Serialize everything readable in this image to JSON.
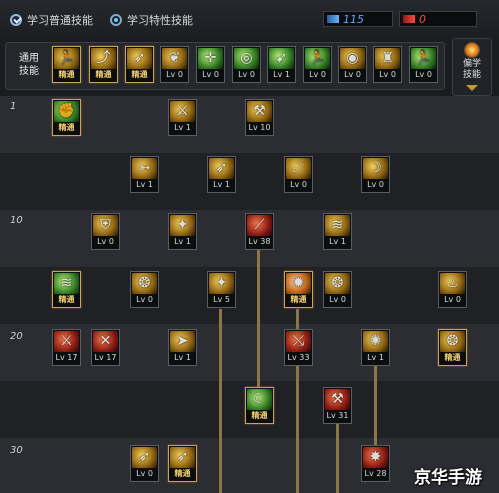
{
  "header": {
    "radio_normal_label": "学习普通技能",
    "radio_special_label": "学习特性技能",
    "sp_blue_value": "115",
    "sp_red_value": "0"
  },
  "category_bar": {
    "label_line1": "通用",
    "label_line2": "技能"
  },
  "right_button": {
    "label_line1": "偏学",
    "label_line2": "技能"
  },
  "row_labels": [
    "1",
    "10",
    "20",
    "30"
  ],
  "skills": [
    {
      "id": "top-1",
      "label": "精通",
      "mastery": true,
      "icon": "running-figure-icon",
      "color": "ye"
    },
    {
      "id": "top-2",
      "label": "精通",
      "mastery": true,
      "icon": "leaping-figure-icon",
      "color": "ye"
    },
    {
      "id": "top-3",
      "label": "精通",
      "mastery": true,
      "icon": "sprinting-figure-icon",
      "color": "ye"
    },
    {
      "id": "top-4",
      "label": "Lv 0",
      "mastery": false,
      "icon": "wings-icon",
      "color": "ye"
    },
    {
      "id": "top-5",
      "label": "Lv 0",
      "mastery": false,
      "icon": "crosshair-icon",
      "color": "gr"
    },
    {
      "id": "top-6",
      "label": "Lv 0",
      "mastery": false,
      "icon": "target-icon",
      "color": "gr"
    },
    {
      "id": "top-7",
      "label": "Lv 1",
      "mastery": false,
      "icon": "runner-icon",
      "color": "gr"
    },
    {
      "id": "top-8",
      "label": "Lv 0",
      "mastery": false,
      "icon": "running-figure-icon",
      "color": "gr"
    },
    {
      "id": "top-9",
      "label": "Lv 0",
      "mastery": false,
      "icon": "eye-icon",
      "color": "ye"
    },
    {
      "id": "top-10",
      "label": "Lv 0",
      "mastery": false,
      "icon": "warrior-icon",
      "color": "ye"
    },
    {
      "id": "top-11",
      "label": "Lv 0",
      "mastery": false,
      "icon": "running-figure-icon",
      "color": "gr"
    },
    {
      "id": "r1-a",
      "label": "精通",
      "mastery": true,
      "icon": "fighter-icon",
      "color": "gr"
    },
    {
      "id": "r1-b",
      "label": "Lv 1",
      "mastery": false,
      "icon": "dagger-icon",
      "color": "ye"
    },
    {
      "id": "r1-c",
      "label": "Lv 10",
      "mastery": false,
      "icon": "hammer-icon",
      "color": "ye"
    },
    {
      "id": "r2-a",
      "label": "Lv 1",
      "mastery": false,
      "icon": "dash-figure-icon",
      "color": "ye"
    },
    {
      "id": "r2-b",
      "label": "Lv 1",
      "mastery": false,
      "icon": "sprinting-figure-icon",
      "color": "ye"
    },
    {
      "id": "r2-c",
      "label": "Lv 0",
      "mastery": false,
      "icon": "fireball-icon",
      "color": "ye"
    },
    {
      "id": "r2-d",
      "label": "Lv 0",
      "mastery": false,
      "icon": "crescent-icon",
      "color": "ye"
    },
    {
      "id": "r3-a",
      "label": "Lv 0",
      "mastery": false,
      "icon": "shield-icon",
      "color": "ye"
    },
    {
      "id": "r3-b",
      "label": "Lv 1",
      "mastery": false,
      "icon": "kick-icon",
      "color": "ye"
    },
    {
      "id": "r3-c",
      "label": "Lv 38",
      "mastery": false,
      "icon": "slash-icon",
      "color": "rd"
    },
    {
      "id": "r3-d",
      "label": "Lv 1",
      "mastery": false,
      "icon": "wind-slash-icon",
      "color": "ye"
    },
    {
      "id": "r4-a",
      "label": "精通",
      "mastery": true,
      "icon": "wind-slash-icon",
      "color": "gr"
    },
    {
      "id": "r4-b",
      "label": "Lv 0",
      "mastery": false,
      "icon": "swirl-icon",
      "color": "ye"
    },
    {
      "id": "r4-c",
      "label": "Lv 5",
      "mastery": false,
      "icon": "kick-icon",
      "color": "ye"
    },
    {
      "id": "r4-d",
      "label": "精通",
      "mastery": true,
      "icon": "burst-icon",
      "color": "or"
    },
    {
      "id": "r4-e",
      "label": "Lv 0",
      "mastery": false,
      "icon": "swirl-icon",
      "color": "ye"
    },
    {
      "id": "r4-f",
      "label": "Lv 0",
      "mastery": false,
      "icon": "flame-icon",
      "color": "ye"
    },
    {
      "id": "r5-a",
      "label": "Lv 17",
      "mastery": false,
      "icon": "crossed-swords-icon",
      "color": "rd"
    },
    {
      "id": "r5-b",
      "label": "Lv 17",
      "mastery": false,
      "icon": "crossed-blades-icon",
      "color": "rd"
    },
    {
      "id": "r5-c",
      "label": "Lv 1",
      "mastery": false,
      "icon": "rush-icon",
      "color": "ye"
    },
    {
      "id": "r5-d",
      "label": "Lv 33",
      "mastery": false,
      "icon": "rising-slash-icon",
      "color": "rd"
    },
    {
      "id": "r5-e",
      "label": "Lv 1",
      "mastery": false,
      "icon": "vortex-icon",
      "color": "ye"
    },
    {
      "id": "r5-f",
      "label": "精通",
      "mastery": true,
      "icon": "swirl-icon",
      "color": "ye"
    },
    {
      "id": "r6-a",
      "label": "精通",
      "mastery": true,
      "icon": "crescent-slash-icon",
      "color": "gr"
    },
    {
      "id": "r6-b",
      "label": "Lv 31",
      "mastery": false,
      "icon": "axe-icon",
      "color": "rd"
    },
    {
      "id": "r7-a",
      "label": "Lv 0",
      "mastery": false,
      "icon": "flying-kick-icon",
      "color": "ye"
    },
    {
      "id": "r7-b",
      "label": "精通",
      "mastery": true,
      "icon": "sprinting-figure-icon",
      "color": "ye"
    },
    {
      "id": "r7-c",
      "label": "Lv 28",
      "mastery": false,
      "icon": "fire-slash-icon",
      "color": "rd"
    }
  ],
  "watermark": "京华手游"
}
